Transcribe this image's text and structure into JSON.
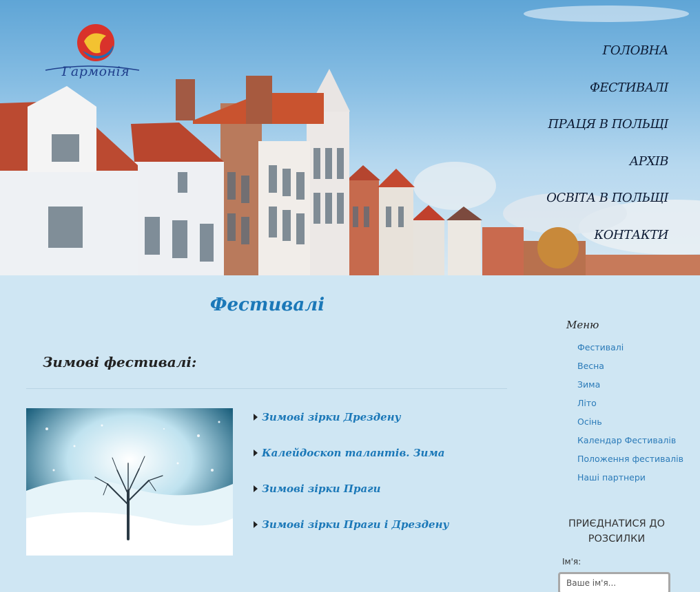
{
  "site": {
    "logo_text": "Гармонія"
  },
  "nav": [
    {
      "label": "ГОЛОВНА"
    },
    {
      "label": "ФЕСТИВАЛІ"
    },
    {
      "label": "ПРАЦЯ В ПОЛЬЩІ"
    },
    {
      "label": "АРХІВ"
    },
    {
      "label": "ОСВІТА В ПОЛЬЩІ"
    },
    {
      "label": "КОНТАКТИ"
    }
  ],
  "main": {
    "page_title": "Фестивалі",
    "section_title": "Зимові фестивалі:",
    "festivals": [
      {
        "label": "Зимові зірки Дрездену"
      },
      {
        "label": "Калейдоскоп талантів. Зима"
      },
      {
        "label": "Зимові зірки Праги"
      },
      {
        "label": "Зимові зірки Праги і Дрездену"
      }
    ]
  },
  "sidebar": {
    "title": "Меню",
    "items": [
      {
        "label": "Фестивалі"
      },
      {
        "label": "Весна"
      },
      {
        "label": "Зима"
      },
      {
        "label": "Літо"
      },
      {
        "label": "Осінь"
      },
      {
        "label": "Календар Фестивалів"
      },
      {
        "label": "Положення фестивалів"
      },
      {
        "label": "Наші партнери"
      }
    ],
    "subscribe": {
      "title": "ПРИЄДНАТИСЯ ДО РОЗСИЛКИ",
      "name_label": "Ім'я:",
      "name_placeholder": "Ваше ім'я..."
    }
  },
  "colors": {
    "background": "#cfe6f3",
    "link": "#1b78b8",
    "sidebar_link": "#2a7ab8",
    "nav_text": "#0c1a33"
  }
}
